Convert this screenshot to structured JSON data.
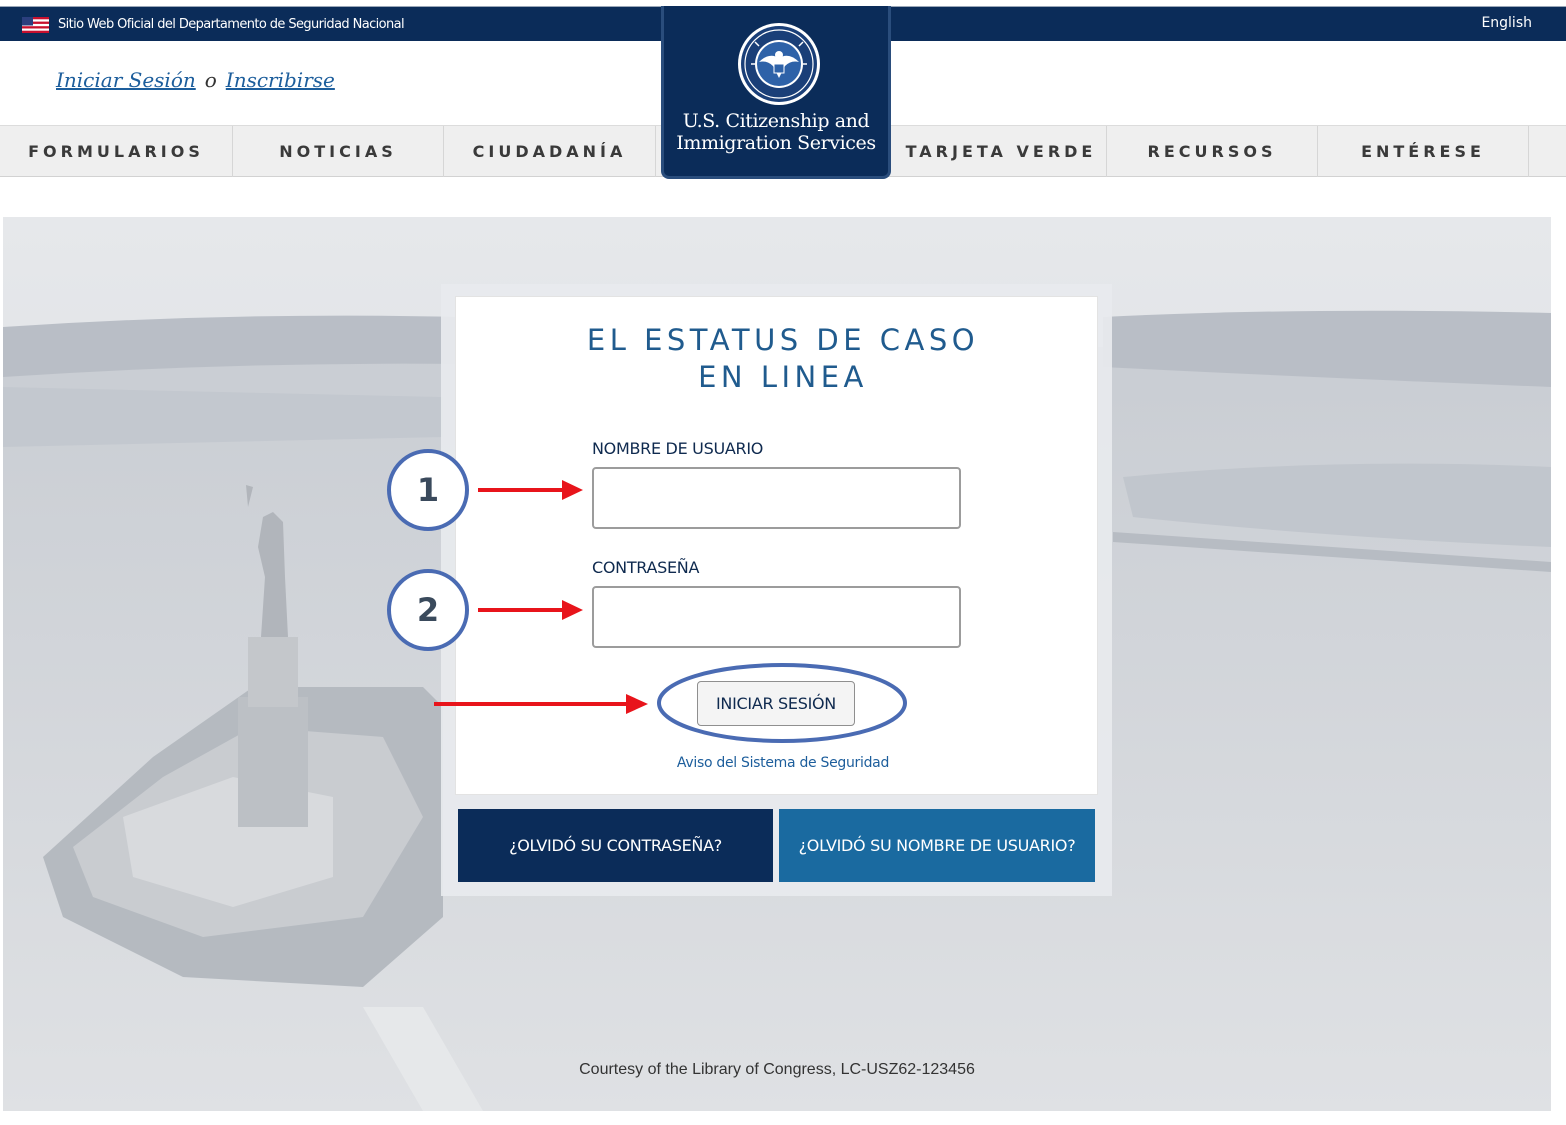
{
  "gov_banner": {
    "text": "Sitio Web Oficial del Departamento de Seguridad Nacional",
    "language_link": "English"
  },
  "account": {
    "sign_in": "Iniciar Sesión",
    "separator": "o",
    "sign_up": "Inscribirse"
  },
  "logo": {
    "agency_line1": "U.S. Citizenship and",
    "agency_line2": "Immigration Services"
  },
  "nav": {
    "items": [
      "FORMULARIOS",
      "NOTICIAS",
      "CIUDADANÍA",
      "TARJETA VERDE",
      "RECURSOS",
      "ENTÉRESE"
    ]
  },
  "login": {
    "title_line1": "EL ESTATUS DE CASO",
    "title_line2": "EN LINEA",
    "username_label": "NOMBRE DE USUARIO",
    "username_value": "",
    "password_label": "CONTRASEÑA",
    "password_value": "",
    "submit_label": "INICIAR SESIÓN",
    "security_notice": "Aviso del Sistema de Seguridad",
    "forgot_password": "¿OLVIDÓ SU CONTRASEÑA?",
    "forgot_username": "¿OLVIDÓ SU NOMBRE DE USUARIO?"
  },
  "hero": {
    "credit": "Courtesy of the Library of Congress, LC-USZ62-123456"
  },
  "annotations": {
    "step1": "1",
    "step2": "2"
  },
  "colors": {
    "navy": "#0b2c59",
    "link_blue": "#1d5e9c",
    "title_blue": "#205b8e",
    "button_blue": "#1a6aa0",
    "annotation_circle": "#4a6bb3",
    "annotation_arrow": "#e8141b"
  }
}
